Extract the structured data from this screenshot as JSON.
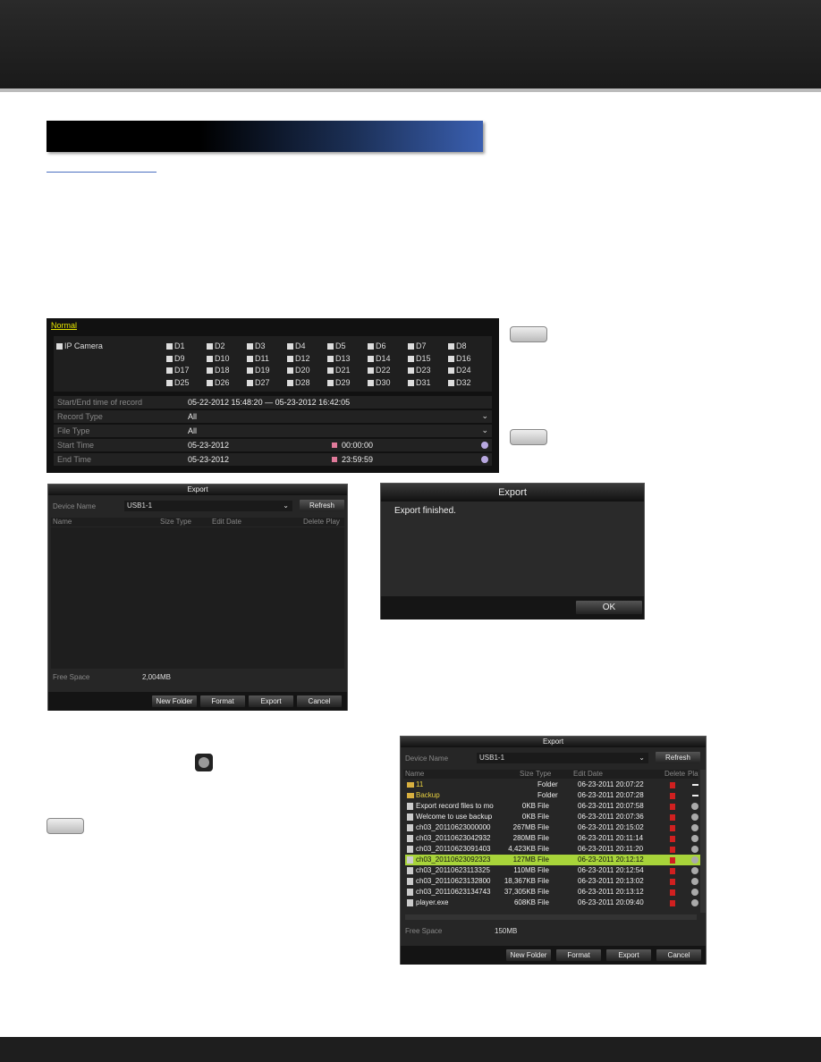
{
  "colors": {
    "accent_yellow": "#e8e800",
    "highlight": "#a8d43a",
    "delete_red": "#d02020"
  },
  "search_form": {
    "tab": "Normal",
    "ip_camera_label": "IP Camera",
    "cameras": [
      "D1",
      "D2",
      "D3",
      "D4",
      "D5",
      "D6",
      "D7",
      "D8",
      "D9",
      "D10",
      "D11",
      "D12",
      "D13",
      "D14",
      "D15",
      "D16",
      "D17",
      "D18",
      "D19",
      "D20",
      "D21",
      "D22",
      "D23",
      "D24",
      "D25",
      "D26",
      "D27",
      "D28",
      "D29",
      "D30",
      "D31",
      "D32"
    ],
    "record_range_label": "Start/End time of record",
    "record_range_value": "05-22-2012 15:48:20  —  05-23-2012 16:42:05",
    "record_type_label": "Record Type",
    "record_type_value": "All",
    "file_type_label": "File Type",
    "file_type_value": "All",
    "start_time_label": "Start Time",
    "start_date": "05-23-2012",
    "start_clock": "00:00:00",
    "end_time_label": "End Time",
    "end_date": "05-23-2012",
    "end_clock": "23:59:59"
  },
  "export_empty": {
    "title": "Export",
    "device_label": "Device Name",
    "device_value": "USB1-1",
    "refresh": "Refresh",
    "col_name": "Name",
    "col_size_type": "Size Type",
    "col_edit_date": "Edit Date",
    "col_delete_play": "Delete Play",
    "free_space_label": "Free Space",
    "free_space_value": "2,004MB",
    "buttons": [
      "New Folder",
      "Format",
      "Export",
      "Cancel"
    ]
  },
  "export_finished": {
    "title": "Export",
    "message": "Export finished.",
    "ok": "OK"
  },
  "export_list": {
    "title": "Export",
    "device_label": "Device Name",
    "device_value": "USB1-1",
    "refresh": "Refresh",
    "col_name": "Name",
    "col_size": "Size",
    "col_type": "Type",
    "col_edit_date": "Edit Date",
    "col_delete": "Delete",
    "col_play": "Play",
    "files": [
      {
        "name": "11",
        "size": "",
        "type": "Folder",
        "date": "06-23-2011 20:07:22",
        "folder": true
      },
      {
        "name": "Backup",
        "size": "",
        "type": "Folder",
        "date": "06-23-2011 20:07:28",
        "folder": true
      },
      {
        "name": "Export record files to mo",
        "size": "0KB",
        "type": "File",
        "date": "06-23-2011 20:07:58"
      },
      {
        "name": "Welcome to use backup",
        "size": "0KB",
        "type": "File",
        "date": "06-23-2011 20:07:36"
      },
      {
        "name": "ch03_20110623000000",
        "size": "267MB",
        "type": "File",
        "date": "06-23-2011 20:15:02"
      },
      {
        "name": "ch03_20110623042932",
        "size": "280MB",
        "type": "File",
        "date": "06-23-2011 20:11:14"
      },
      {
        "name": "ch03_20110623091403",
        "size": "4,423KB",
        "type": "File",
        "date": "06-23-2011 20:11:20"
      },
      {
        "name": "ch03_20110623092323",
        "size": "127MB",
        "type": "File",
        "date": "06-23-2011 20:12:12",
        "selected": true
      },
      {
        "name": "ch03_20110623113325",
        "size": "110MB",
        "type": "File",
        "date": "06-23-2011 20:12:54"
      },
      {
        "name": "ch03_20110623132800",
        "size": "18,367KB",
        "type": "File",
        "date": "06-23-2011 20:13:02"
      },
      {
        "name": "ch03_20110623134743",
        "size": "37,305KB",
        "type": "File",
        "date": "06-23-2011 20:13:12"
      },
      {
        "name": "player.exe",
        "size": "608KB",
        "type": "File",
        "date": "06-23-2011 20:09:40"
      }
    ],
    "free_space_label": "Free Space",
    "free_space_value": "150MB",
    "buttons": [
      "New Folder",
      "Format",
      "Export",
      "Cancel"
    ]
  }
}
